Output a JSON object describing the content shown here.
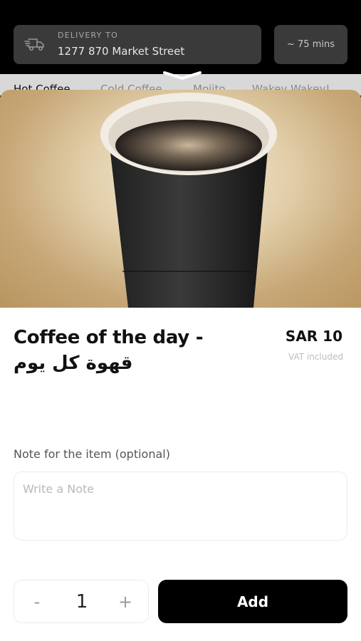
{
  "header": {
    "delivery_label": "DELIVERY TO",
    "delivery_address": "1277 870 Market Street",
    "eta": "~ 75 mins",
    "icon": "delivery-truck-icon"
  },
  "tabs": [
    {
      "label": "Hot Coffee",
      "active": true
    },
    {
      "label": "Cold Coffee",
      "active": false
    },
    {
      "label": "Mojito",
      "active": false
    },
    {
      "label": "Wakey Wakey!",
      "active": false
    }
  ],
  "product": {
    "title_line1": "Coffee of the day -",
    "title_line2": "قهوة كل يوم",
    "price": "SAR 10",
    "vat_note": "VAT included",
    "image_icon": "coffee-cup-photo"
  },
  "note": {
    "label": "Note for the item (optional)",
    "placeholder": "Write a Note",
    "value": ""
  },
  "quantity": {
    "minus": "-",
    "value": "1",
    "plus": "+"
  },
  "actions": {
    "add_label": "Add"
  },
  "colors": {
    "header_bg": "#000000",
    "pill_bg": "#3a3a3a",
    "button_bg": "#000000"
  }
}
